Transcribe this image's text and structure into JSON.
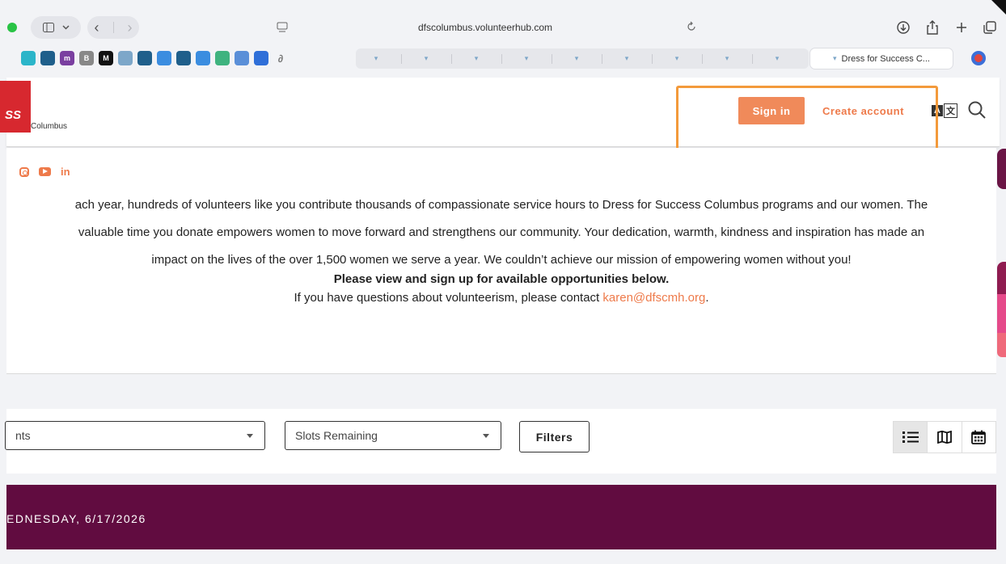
{
  "browser": {
    "url": "dfscolumbus.volunteerhub.com",
    "active_tab_title": "Dress for Success C..."
  },
  "favorites": [
    {
      "icon": "heart-icon",
      "color": "#2bb5c9",
      "label": ""
    },
    {
      "icon": "mountain-icon",
      "color": "#1f5f8b",
      "label": ""
    },
    {
      "icon": "m-icon",
      "color": "#7a3fa0",
      "label": "m"
    },
    {
      "icon": "b-icon",
      "color": "#888888",
      "label": "B"
    },
    {
      "icon": "medium-icon",
      "color": "#111111",
      "label": "M"
    },
    {
      "icon": "v-icon",
      "color": "#7da7c9",
      "label": ""
    },
    {
      "icon": "mountain-icon",
      "color": "#1f5f8b",
      "label": ""
    },
    {
      "icon": "chat-icon",
      "color": "#3b8de0",
      "label": ""
    },
    {
      "icon": "mountain-icon",
      "color": "#1f5f8b",
      "label": ""
    },
    {
      "icon": "chat-icon",
      "color": "#3b8de0",
      "label": ""
    },
    {
      "icon": "square-icon",
      "color": "#3fb37f",
      "label": ""
    },
    {
      "icon": "square-icon",
      "color": "#5a8fd8",
      "label": ""
    },
    {
      "icon": "circle-icon",
      "color": "#2f6fd8",
      "label": ""
    },
    {
      "icon": "feather-icon",
      "color": "#777777",
      "label": ""
    }
  ],
  "site": {
    "logo_text": "SS",
    "logo_subtitle": "Columbus",
    "sign_in_label": "Sign in",
    "create_account_label": "Create account",
    "lang_label_a": "A",
    "lang_label_b": "文"
  },
  "social": [
    "instagram-icon",
    "youtube-icon",
    "linkedin-icon"
  ],
  "intro": {
    "line1": "ach year, hundreds of volunteers like you contribute thousands of compassionate service hours to Dress for Success Columbus programs and our women. The",
    "line2": "valuable time you donate empowers women to move forward and strengthens our community. Your dedication, warmth, kindness and inspiration has made an",
    "line3": "impact on the lives of the over 1,500 women we serve a year. We couldn’t achieve our mission of empowering women without you!",
    "line4": "Please view and sign up for available opportunities below.",
    "line5_prefix": "If you have questions about volunteerism, please contact ",
    "contact_email": "karen@dfscmh.org",
    "line5_suffix": "."
  },
  "filters": {
    "select1_value": "nts",
    "select2_value": "Slots Remaining",
    "filters_label": "Filters"
  },
  "date_header": "EDNESDAY, 6/17/2026",
  "colors": {
    "accent": "#ee7a4a",
    "sign_in_bg": "#f08a5a",
    "highlight": "#f39a3b",
    "date_band": "#610c40"
  }
}
